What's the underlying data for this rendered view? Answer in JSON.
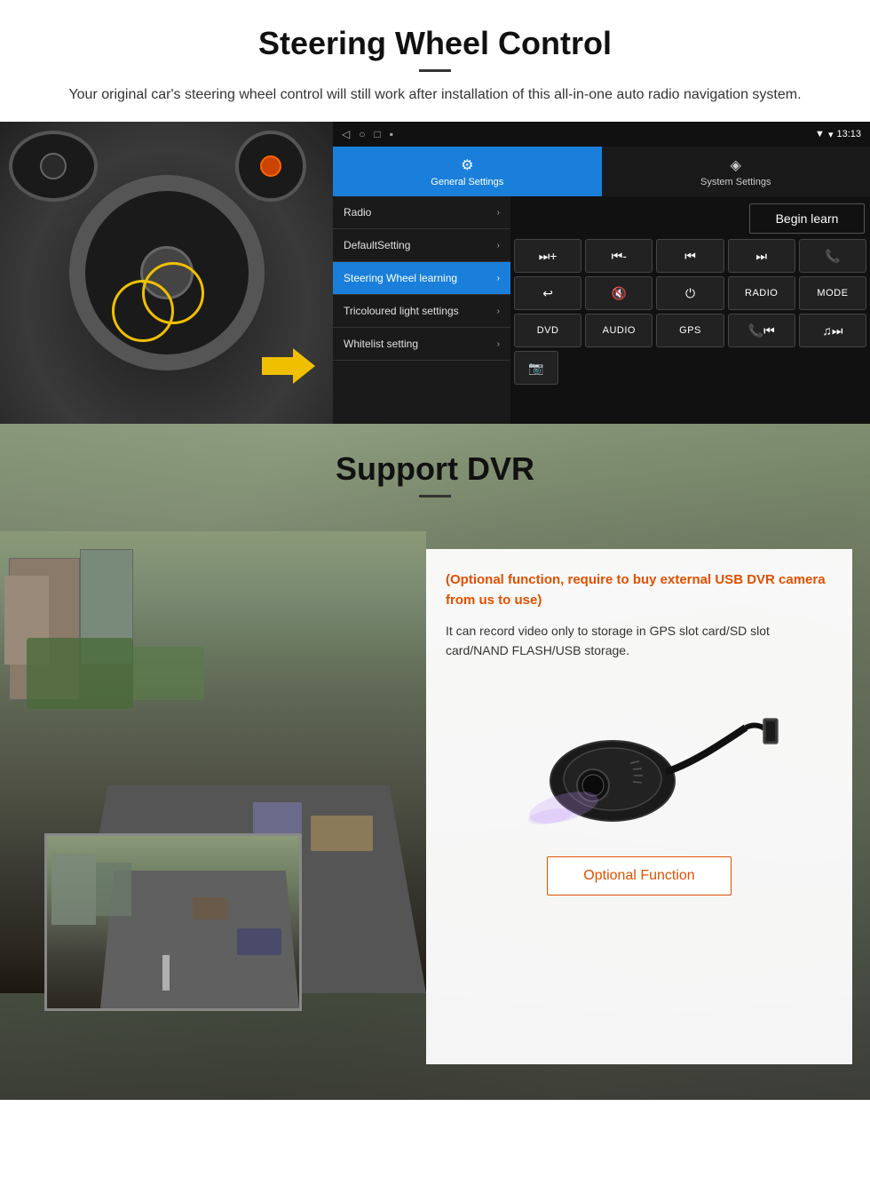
{
  "page": {
    "section1": {
      "title": "Steering Wheel Control",
      "description": "Your original car's steering wheel control will still work after installation of this all-in-one auto radio navigation system.",
      "android_ui": {
        "statusbar": {
          "time": "13:13",
          "signal_icon": "▼",
          "wifi_icon": "▾",
          "battery_icon": "▪"
        },
        "tabs": [
          {
            "id": "general",
            "label": "General Settings",
            "icon": "⚙",
            "active": true
          },
          {
            "id": "system",
            "label": "System Settings",
            "icon": "◈",
            "active": false
          }
        ],
        "menu_items": [
          {
            "label": "Radio",
            "selected": false
          },
          {
            "label": "DefaultSetting",
            "selected": false
          },
          {
            "label": "Steering Wheel learning",
            "selected": true
          },
          {
            "label": "Tricoloured light settings",
            "selected": false
          },
          {
            "label": "Whitelist setting",
            "selected": false
          }
        ],
        "begin_learn_btn": "Begin learn",
        "button_rows": [
          [
            "⏮+",
            "⏮-",
            "⏭",
            "⏭⏭",
            "📞"
          ],
          [
            "↩",
            "🔇",
            "⏻",
            "RADIO",
            "MODE"
          ],
          [
            "DVD",
            "AUDIO",
            "GPS",
            "📞⏭",
            "🎵⏭"
          ],
          [
            "📷"
          ]
        ]
      }
    },
    "section2": {
      "title": "Support DVR",
      "optional_warning": "(Optional function, require to buy external USB DVR camera from us to use)",
      "description": "It can record video only to storage in GPS slot card/SD slot card/NAND FLASH/USB storage.",
      "optional_btn_label": "Optional Function"
    }
  }
}
